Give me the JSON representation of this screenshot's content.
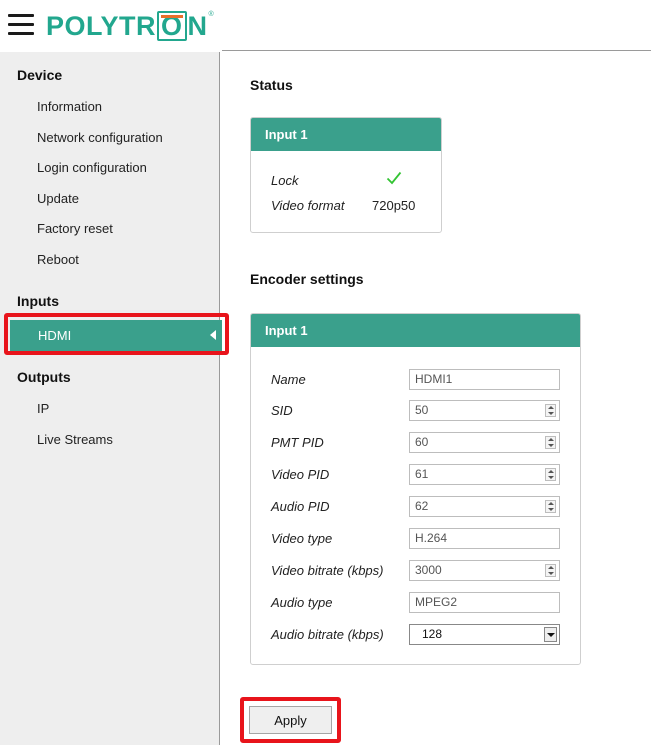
{
  "header": {
    "logo_text_a": "POLYTR",
    "logo_text_box": "O",
    "logo_text_b": "N",
    "logo_mark": "®",
    "menu_icon": "hamburger-menu-icon"
  },
  "sidebar": {
    "device_heading": "Device",
    "device_items": [
      "Information",
      "Network configuration",
      "Login configuration",
      "Update",
      "Factory reset",
      "Reboot"
    ],
    "inputs_heading": "Inputs",
    "inputs_active": "HDMI",
    "outputs_heading": "Outputs",
    "outputs_items": [
      "IP",
      "Live Streams"
    ]
  },
  "status": {
    "title": "Status",
    "card_title": "Input 1",
    "lock_label": "Lock",
    "lock_icon": "checkmark-icon",
    "video_format_label": "Video format",
    "video_format_value": "720p50"
  },
  "encoder": {
    "title": "Encoder settings",
    "card_title": "Input 1",
    "fields": [
      {
        "label": "Name",
        "value": "HDMI1",
        "kind": "text"
      },
      {
        "label": "SID",
        "value": "50",
        "kind": "spin"
      },
      {
        "label": "PMT PID",
        "value": "60",
        "kind": "spin"
      },
      {
        "label": "Video PID",
        "value": "61",
        "kind": "spin"
      },
      {
        "label": "Audio PID",
        "value": "62",
        "kind": "spin"
      },
      {
        "label": "Video type",
        "value": "H.264",
        "kind": "text"
      },
      {
        "label": "Video bitrate (kbps)",
        "value": "3000",
        "kind": "spin"
      },
      {
        "label": "Audio type",
        "value": "MPEG2",
        "kind": "text"
      },
      {
        "label": "Audio bitrate (kbps)",
        "value": "128",
        "kind": "select"
      }
    ]
  },
  "actions": {
    "apply_label": "Apply"
  },
  "colors": {
    "accent": "#3aa08c",
    "highlight": "#e8141b"
  }
}
